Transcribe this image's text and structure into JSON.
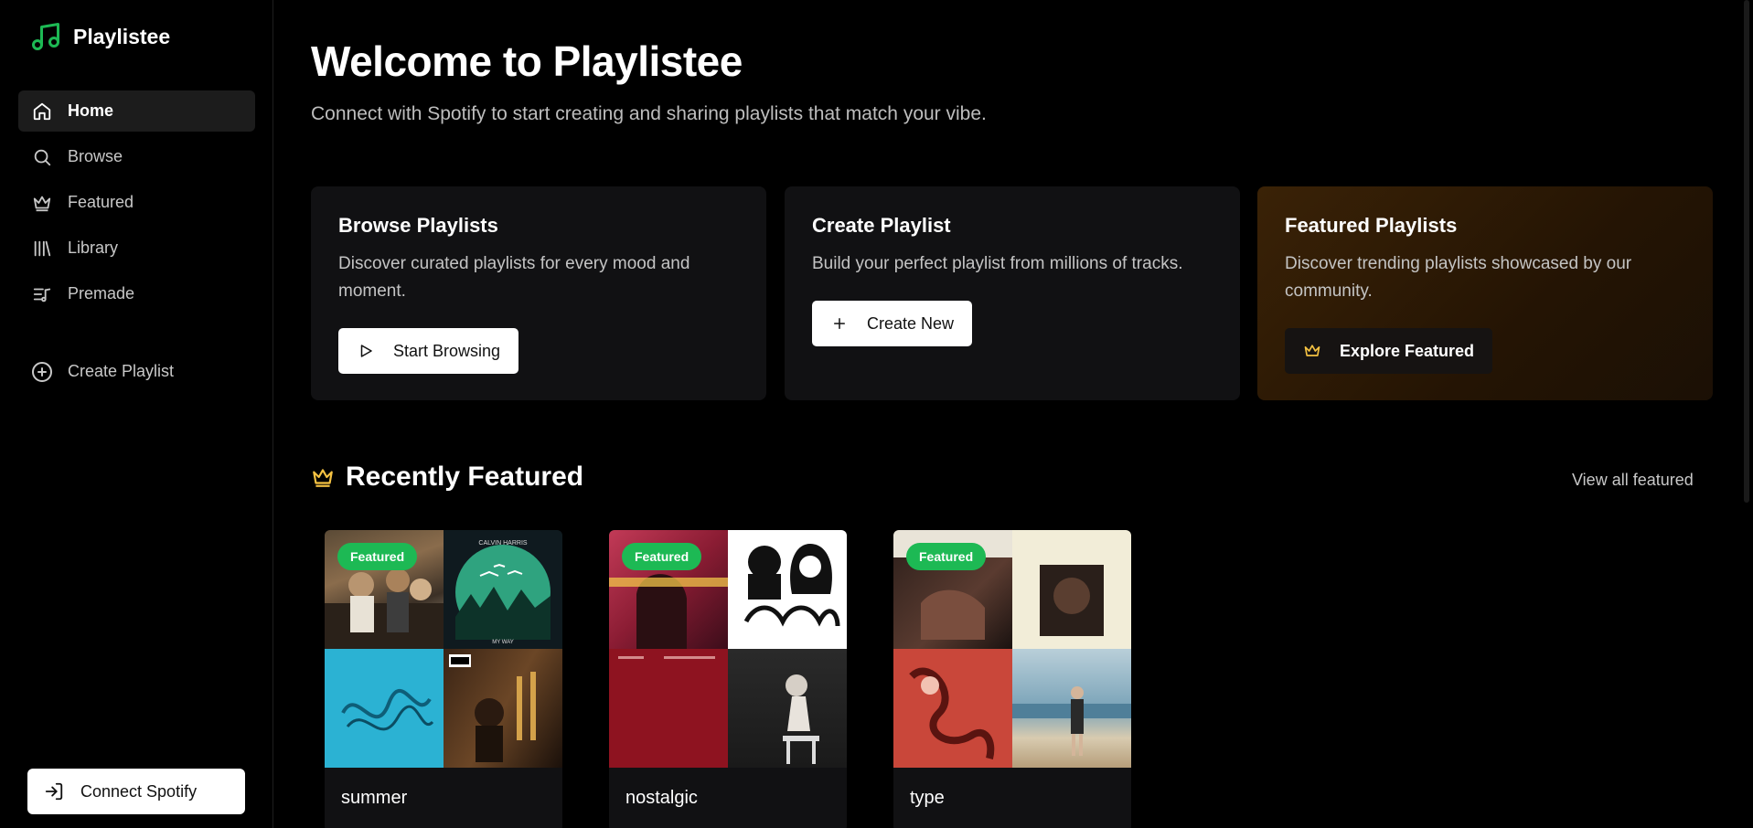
{
  "app": {
    "name": "Playlistee"
  },
  "sidebar": {
    "items": [
      {
        "label": "Home",
        "icon": "home-icon",
        "active": true
      },
      {
        "label": "Browse",
        "icon": "search-icon"
      },
      {
        "label": "Featured",
        "icon": "crown-icon"
      },
      {
        "label": "Library",
        "icon": "library-icon"
      },
      {
        "label": "Premade",
        "icon": "list-music-icon"
      }
    ],
    "create_label": "Create Playlist",
    "connect_label": "Connect Spotify"
  },
  "main": {
    "title": "Welcome to Playlistee",
    "subtitle": "Connect with Spotify to start creating and sharing playlists that match your vibe.",
    "cards": [
      {
        "title": "Browse Playlists",
        "desc": "Discover curated playlists for every mood and moment.",
        "button": "Start Browsing",
        "icon": "play-icon"
      },
      {
        "title": "Create Playlist",
        "desc": "Build your perfect playlist from millions of tracks.",
        "button": "Create New",
        "icon": "plus-icon"
      },
      {
        "title": "Featured Playlists",
        "desc": "Discover trending playlists showcased by our community.",
        "button": "Explore Featured",
        "icon": "crown-icon"
      }
    ],
    "section_title": "Recently Featured",
    "view_all": "View all featured",
    "playlists": [
      {
        "name": "summer",
        "badge": "Featured"
      },
      {
        "name": "nostalgic",
        "badge": "Featured"
      },
      {
        "name": "type",
        "badge": "Featured"
      }
    ]
  },
  "colors": {
    "accent": "#1db954",
    "gold": "#f5c242",
    "background": "#000000"
  }
}
